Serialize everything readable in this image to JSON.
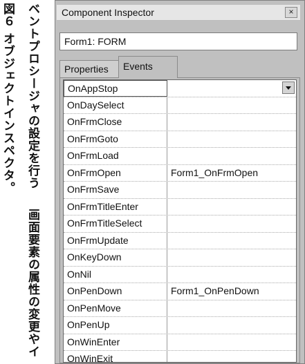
{
  "caption": {
    "col1": "図６ オブジェクトインスペクタ。",
    "col2": "ベントプロシージャの設定を行う",
    "col3": "画面要素の属性の変更やイ"
  },
  "window": {
    "title": "Component Inspector",
    "close_label": "×",
    "object": "Form1: FORM"
  },
  "tabs": {
    "properties": "Properties",
    "events": "Events"
  },
  "events": [
    {
      "name": "OnAppStop",
      "value": ""
    },
    {
      "name": "OnDaySelect",
      "value": ""
    },
    {
      "name": "OnFrmClose",
      "value": ""
    },
    {
      "name": "OnFrmGoto",
      "value": ""
    },
    {
      "name": "OnFrmLoad",
      "value": ""
    },
    {
      "name": "OnFrmOpen",
      "value": "Form1_OnFrmOpen"
    },
    {
      "name": "OnFrmSave",
      "value": ""
    },
    {
      "name": "OnFrmTitleEnter",
      "value": ""
    },
    {
      "name": "OnFrmTitleSelect",
      "value": ""
    },
    {
      "name": "OnFrmUpdate",
      "value": ""
    },
    {
      "name": "OnKeyDown",
      "value": ""
    },
    {
      "name": "OnNil",
      "value": ""
    },
    {
      "name": "OnPenDown",
      "value": "Form1_OnPenDown"
    },
    {
      "name": "OnPenMove",
      "value": ""
    },
    {
      "name": "OnPenUp",
      "value": ""
    },
    {
      "name": "OnWinEnter",
      "value": ""
    },
    {
      "name": "OnWinExit",
      "value": ""
    }
  ]
}
